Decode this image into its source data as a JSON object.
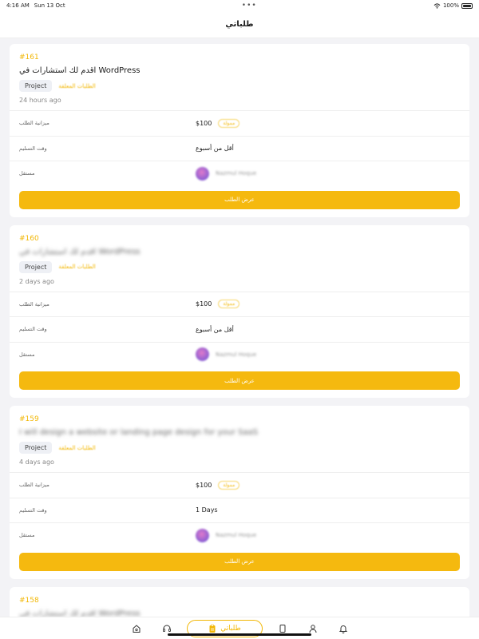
{
  "status": {
    "time": "4:16 AM",
    "date": "Sun 13 Oct",
    "dots": "•••",
    "battery": "100%",
    "battery_level": 1.0
  },
  "header": {
    "title": "طلباتي"
  },
  "labels": {
    "budget": "ميزانية الطلب",
    "delivery": "وقت التسليم",
    "freelancer": "مستقل",
    "view_button": "عرض الطلب"
  },
  "orders": [
    {
      "id": "#161",
      "title": "اقدم لك استشارات في WordPress",
      "tag": "Project",
      "status_tag": "الطلبات المعلقة",
      "time": "24 hours ago",
      "budget": "$100",
      "paid_badge": "ممولة",
      "delivery": "أقل من أسبوع",
      "freelancer": "Nazmul Hoque"
    },
    {
      "id": "#160",
      "title": "اقدم لك استشارات في WordPress",
      "tag": "Project",
      "status_tag": "الطلبات المعلقة",
      "time": "2 days ago",
      "budget": "$100",
      "paid_badge": "ممولة",
      "delivery": "أقل من أسبوع",
      "freelancer": "Nazmul Hoque"
    },
    {
      "id": "#159",
      "title": "I will design a website or landing page design for your SaaS",
      "tag": "Project",
      "status_tag": "الطلبات المعلقة",
      "time": "4 days ago",
      "budget": "$100",
      "paid_badge": "ممولة",
      "delivery": "1 Days",
      "freelancer": "Nazmul Hoque"
    },
    {
      "id": "#158",
      "title": "اقدم لك استشارات في WordPress"
    }
  ],
  "nav": {
    "active_label": "طلباتي",
    "items": [
      "home-icon",
      "headset-icon",
      "orders-icon",
      "bookmark-icon",
      "profile-icon",
      "bell-icon"
    ]
  },
  "colors": {
    "accent": "#f5b90f",
    "background": "#f3f3f6"
  }
}
